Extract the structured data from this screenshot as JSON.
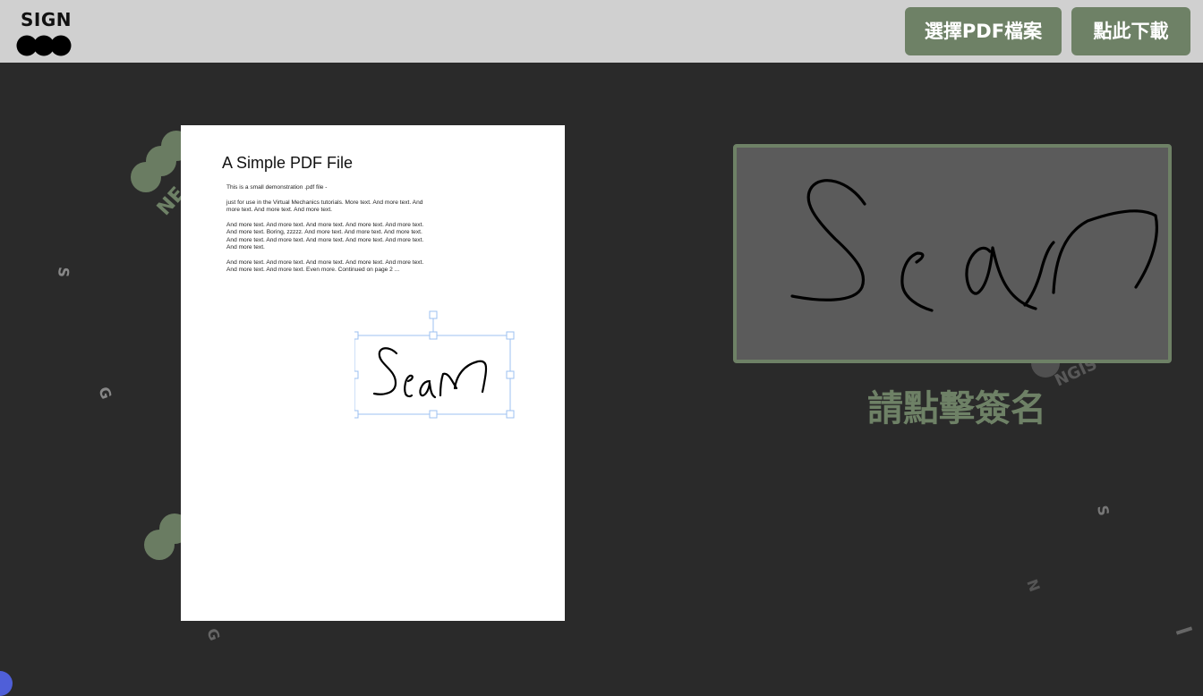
{
  "app": {
    "logo_text": "SIGN"
  },
  "header": {
    "select_pdf_label": "選擇PDF檔案",
    "download_label": "點此下載"
  },
  "pdf": {
    "title": "A Simple PDF File",
    "paragraphs": [
      "This is a small demonstration .pdf file -",
      "just for use in the Virtual Mechanics tutorials. More text. And more text. And more text. And more text. And more text.",
      "And more text. And more text. And more text. And more text. And more text. And more text. Boring, zzzzz. And more text. And more text. And more text. And more text. And more text. And more text. And more text. And more text. And more text.",
      "And more text. And more text. And more text. And more text. And more text. And more text. And more text. Even more. Continued on page 2 ..."
    ]
  },
  "signature": {
    "hint": "請點擊簽名"
  },
  "background": {
    "watermark_letters": [
      "NE",
      "S",
      "G",
      "G",
      "N",
      "S",
      "NGIS"
    ]
  },
  "colors": {
    "topbar": "#d0d0d0",
    "workspace": "#2a2a2a",
    "accent": "#6e8166",
    "pad_fill": "#5b5b5b",
    "page": "#ffffff",
    "handle": "#9cc0f0"
  },
  "icons": {
    "logo": "three-dots-logo",
    "corner": "blue-circle-indicator"
  }
}
